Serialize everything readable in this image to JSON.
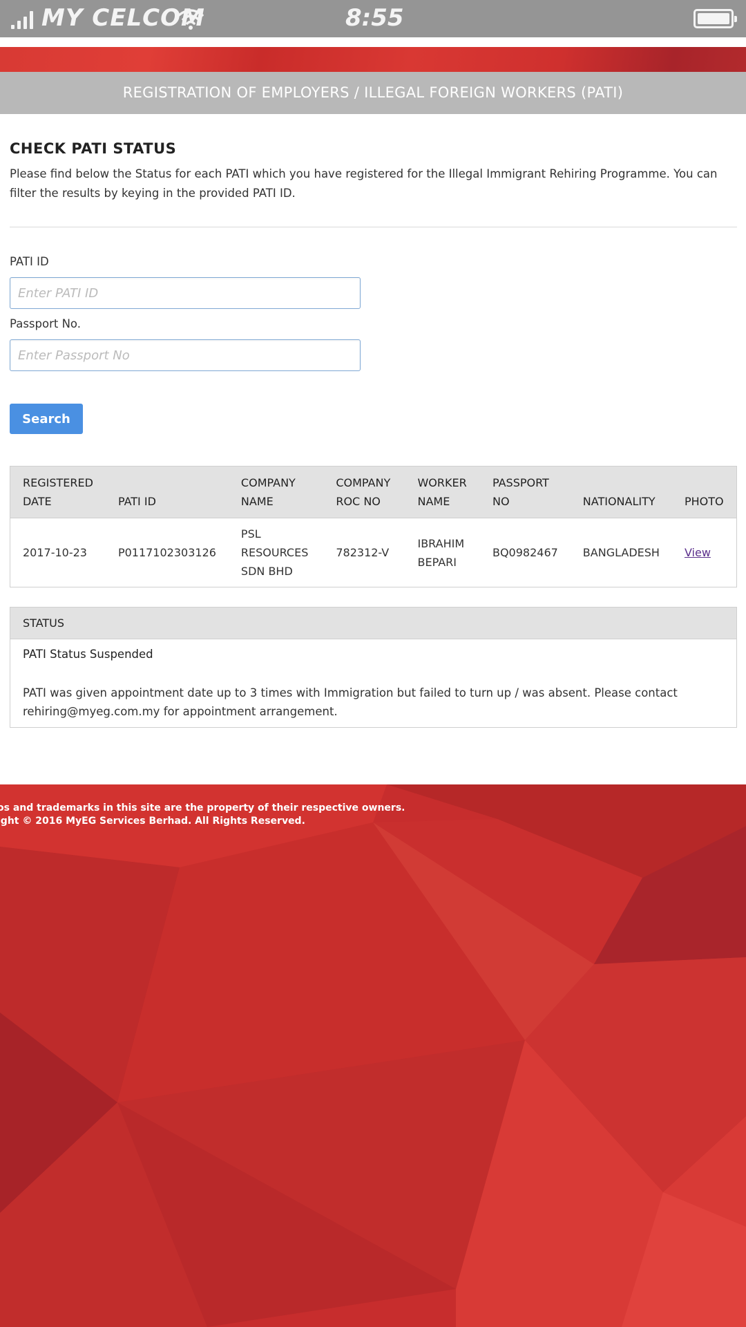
{
  "status_bar": {
    "carrier": "MY CELCOM",
    "time": "8:55",
    "signal_icon": "signal-bars-icon",
    "wifi_icon": "wifi-icon",
    "battery_icon": "battery-icon"
  },
  "header": {
    "title": "REGISTRATION OF EMPLOYERS / ILLEGAL FOREIGN WORKERS (PATI)"
  },
  "section": {
    "title": "CHECK PATI STATUS",
    "description": "Please find below the Status for each PATI which you have registered for the Illegal Immigrant Rehiring Programme. You can filter the results by keying in the provided PATI ID."
  },
  "form": {
    "pati_id_label": "PATI ID",
    "pati_id_placeholder": "Enter PATI ID",
    "pati_id_value": "",
    "passport_label": "Passport No.",
    "passport_placeholder": "Enter Passport No",
    "passport_value": "",
    "search_label": "Search"
  },
  "table": {
    "headers": [
      "Registered Date",
      "PATI ID",
      "Company Name",
      "Company ROC No",
      "Worker Name",
      "Passport No",
      "Nationality",
      "Photo"
    ],
    "rows": [
      [
        "2017-10-23",
        "P0117102303126",
        "PSL RESOURCES SDN BHD",
        "782312-V",
        "IBRAHIM BEPARI",
        "BQ0982467",
        "BANGLADESH",
        "View"
      ]
    ]
  },
  "status": {
    "header": "STATUS",
    "title": "PATI Status Suspended",
    "message": "PATI was given appointment date up to 3 times with Immigration but failed to turn up / was absent. Please contact rehiring@myeg.com.my for appointment arrangement."
  },
  "footer": {
    "line1": "os and trademarks in this site are the property of their respective owners.",
    "line2": "ight © 2016 MyEG Services Berhad. All Rights Reserved."
  },
  "colors": {
    "accent_red": "#c72d2d",
    "button_blue": "#4a90e2",
    "header_gray": "#b8b8b8",
    "statusbar_gray": "#959595"
  }
}
